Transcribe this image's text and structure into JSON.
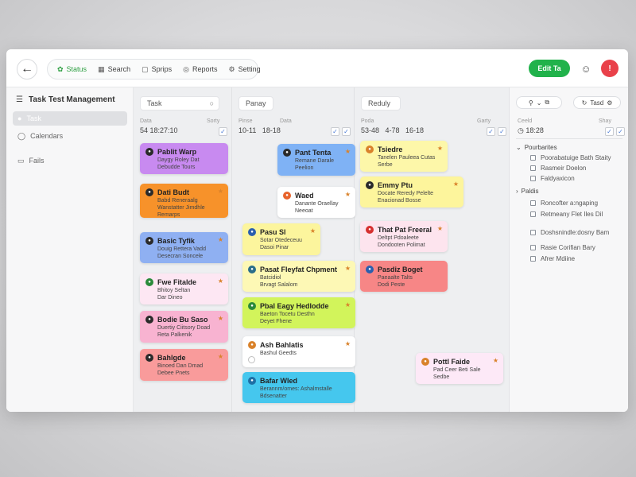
{
  "topbar": {
    "back_icon": "arrow-left-icon",
    "toolbar": [
      {
        "label": "Status",
        "icon": "leaf-icon",
        "active": true
      },
      {
        "label": "Search",
        "icon": "grid-icon",
        "active": false
      },
      {
        "label": "Sprips",
        "icon": "box-icon",
        "active": false
      },
      {
        "label": "Reports",
        "icon": "target-icon",
        "active": false
      },
      {
        "label": "Setting",
        "icon": "gear-icon",
        "active": false
      }
    ],
    "primary_button": "Edit Ta",
    "avatar_initial": "!"
  },
  "sidebar": {
    "title": "Task Test Management",
    "items": [
      {
        "label": "Task",
        "icon": "task-icon"
      },
      {
        "label": "Calendars",
        "icon": "calendar-icon"
      },
      {
        "label": "Fails",
        "icon": "folder-icon"
      }
    ]
  },
  "columns": [
    {
      "header": "Task",
      "meta_left": "Data",
      "meta_right": "Sorty",
      "nums": "54 18:27:10",
      "cards": [
        {
          "title": "Pablit Warp",
          "lines": [
            "Daygy Roley Dat",
            "Debudde Tours"
          ],
          "color": "#c88af0"
        },
        {
          "title": "Dati Budt",
          "lines": [
            "Babd Reneraalg",
            "Wanstatter Jimdhle",
            "Remarps"
          ],
          "color": "#f7922a"
        },
        {
          "title": "Basic Tyfik",
          "lines": [
            "Douig Rettera Vadd",
            "Desecran Soncele"
          ],
          "color": "#8fb0f2"
        },
        {
          "title": "Fwe Fitalde",
          "lines": [
            "Bhitoy Seltan",
            "Dar Dineo"
          ],
          "color": "#fde7f3"
        },
        {
          "title": "Bodie Bu Saso",
          "lines": [
            "Duertiy Ciitsory Doad",
            "Reta Palkenik"
          ],
          "color": "#f8b3d1"
        },
        {
          "title": "Bahlgde",
          "lines": [
            "Binoed Dan Dmad",
            "Debee Pnets"
          ],
          "color": "#f99b9b"
        }
      ]
    },
    {
      "header": "Panay",
      "meta_left": "Pinse",
      "meta_right": "Data",
      "nums": "10-11   18-18",
      "cards": [
        {
          "title": "Pant Tenta",
          "lines": [
            "Remane Darale",
            "Peelion"
          ],
          "color": "#7fb2f5"
        },
        {
          "title": "Waed",
          "lines": [
            "Danante Oraellay",
            "Neeoat"
          ],
          "color": "#ffffff"
        },
        {
          "title": "Pasu Sl",
          "lines": [
            "Sotar Otedeceuu",
            "Dasoi Pinar"
          ],
          "color": "#fcf59d"
        },
        {
          "title": "Pasat Fleyfat Chpment",
          "lines": [
            "Batcidiol",
            "Brvagt Salalom"
          ],
          "color": "#fdf8b5"
        },
        {
          "title": "Pbal Eagy Hedlodde",
          "lines": [
            "Baeton Tocetu Desthn",
            "Deyet Fhene"
          ],
          "color": "#d2f45b"
        },
        {
          "title": "Ash Bahlatis",
          "lines": [
            "Bashul Geedts"
          ],
          "color": "#ffffff"
        },
        {
          "title": "Bafar Wled",
          "lines": [
            "Berannm/omes: Ashalmstalle",
            "Bdsenatter"
          ],
          "color": "#45c7ee"
        }
      ]
    },
    {
      "header": "Reduly",
      "meta_left": "Poda",
      "meta_right": "Garty",
      "nums": "53-48   4-78   16-18",
      "cards": [
        {
          "title": "Tsiedre",
          "lines": [
            "Tanelen Pauleea Cutas",
            "Serbe"
          ],
          "color": "#fdf7a9"
        },
        {
          "title": "Emmy Ptu",
          "lines": [
            "Docate Reredy Pelelte",
            "Enacionad Bosse"
          ],
          "color": "#fdf59c"
        },
        {
          "title": "That Pat Freeral",
          "lines": [
            "Deltpt Pdoaleete",
            "Dondooten Polimat"
          ],
          "color": "#fde4ee"
        },
        {
          "title": "Pasdiz Boget",
          "lines": [
            "Paeaalte Talts",
            "Dodi Peste"
          ],
          "color": "#f78686"
        },
        {
          "title": "Pottl Faide",
          "lines": [
            "Pad Ceer Beti Sale",
            "Sedbe"
          ],
          "color": "#fde9f7"
        }
      ]
    }
  ],
  "right_panel": {
    "buttons": [
      "Q",
      "Tasd"
    ],
    "meta_left": "Ceeld",
    "meta_right": "Shay",
    "nums": "18:28",
    "sections": [
      {
        "title": "Pourbarites",
        "items": [
          "Poorabatuige Bath Staity",
          "Rasmeir Doelon",
          "Faldyaxicon"
        ]
      },
      {
        "title": "Paldis",
        "items": [
          "Roncofter a:ngaping",
          "Retmeany Flet Iles Dil",
          "Doshsnindle:dosny Bam",
          "Rasie Corifian Bary",
          "Afrer Mdiine"
        ]
      }
    ]
  }
}
